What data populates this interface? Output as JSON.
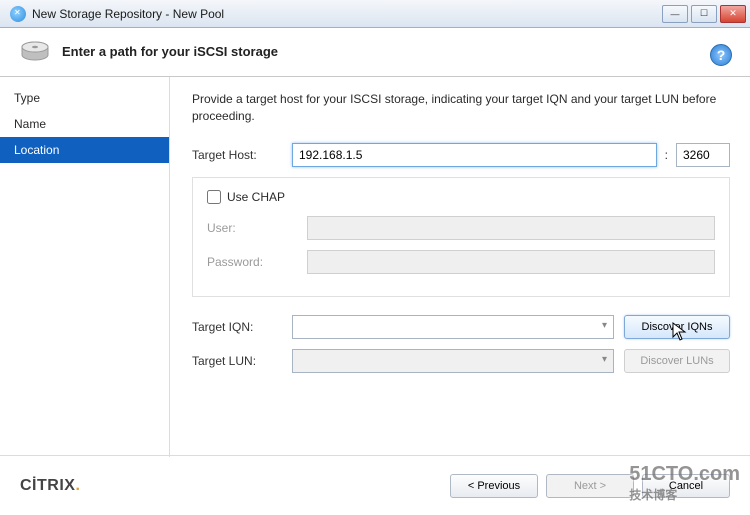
{
  "window": {
    "title": "New Storage Repository - New Pool"
  },
  "header": {
    "heading": "Enter a path for your iSCSI storage"
  },
  "sidebar": {
    "steps": [
      "Type",
      "Name",
      "Location"
    ],
    "active_index": 2
  },
  "content": {
    "intro": "Provide a target host for your ISCSI storage, indicating your target IQN and your target LUN before proceeding.",
    "target_host_label": "Target Host:",
    "target_host_value": "192.168.1.5",
    "port_separator": ":",
    "port_value": "3260",
    "chap": {
      "checkbox_label": "Use CHAP",
      "checked": false,
      "user_label": "User:",
      "user_value": "",
      "password_label": "Password:",
      "password_value": ""
    },
    "iqn_label": "Target IQN:",
    "iqn_value": "",
    "discover_iqns": "Discover IQNs",
    "lun_label": "Target LUN:",
    "lun_value": "",
    "discover_luns": "Discover LUNs"
  },
  "footer": {
    "brand": "CİTRIX",
    "prev": "< Previous",
    "next": "Next >",
    "cancel": "Cancel"
  },
  "watermark": {
    "main": "51CTO.com",
    "sub": "技术博客"
  }
}
